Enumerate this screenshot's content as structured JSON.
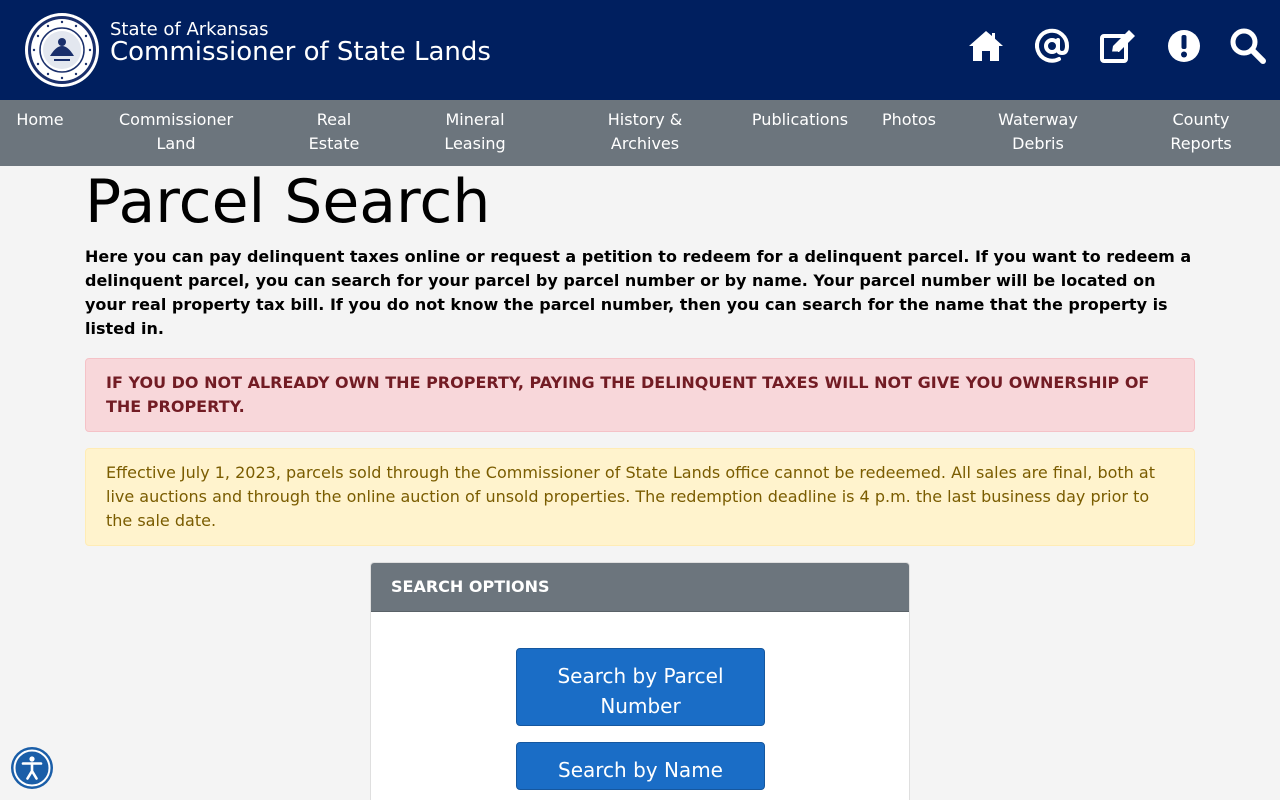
{
  "header": {
    "org_sub": "State of Arkansas",
    "org_title": "Commissioner of State Lands",
    "seal_text": "COMMISSIONER OF STATE LANDS ARKANSAS",
    "icons": [
      "home-icon",
      "email-at-icon",
      "edit-icon",
      "alert-icon",
      "search-icon"
    ]
  },
  "nav": {
    "items": [
      "Home",
      "Commissioner\nLand",
      "Real\nEstate",
      "Mineral\nLeasing",
      "History &\nArchives",
      "Publications",
      "Photos",
      "Waterway\nDebris",
      "County\nReports"
    ]
  },
  "main": {
    "title": "Parcel Search",
    "intro": "Here you can pay delinquent taxes online or request a petition to redeem for a delinquent parcel. If you want to redeem a delinquent parcel, you can search for your parcel by parcel number or by name. Your parcel number will be located on your real property tax bill. If you do not know the parcel number, then you can search for the name that the property is listed in.",
    "danger_alert": "IF YOU DO NOT ALREADY OWN THE PROPERTY, PAYING THE DELINQUENT TAXES WILL NOT GIVE YOU OWNERSHIP OF THE PROPERTY.",
    "warning_alert": "Effective July 1, 2023, parcels sold through the Commissioner of State Lands office cannot be redeemed. All sales are final, both at live auctions and through the online auction of unsold properties. The redemption deadline is 4 p.m. the last business day prior to the sale date."
  },
  "search_options": {
    "header": "SEARCH OPTIONS",
    "by_parcel": "Search by Parcel Number",
    "by_name": "Search by Name"
  },
  "accessibility": {
    "icon": "accessibility-icon"
  },
  "colors": {
    "header_bg": "#001f5f",
    "nav_bg": "#6c757d",
    "primary_button": "#1a6dc6",
    "danger_bg": "#f8d7da",
    "danger_text": "#721c24",
    "warning_bg": "#fff3cd",
    "warning_text": "#7a5c00"
  }
}
